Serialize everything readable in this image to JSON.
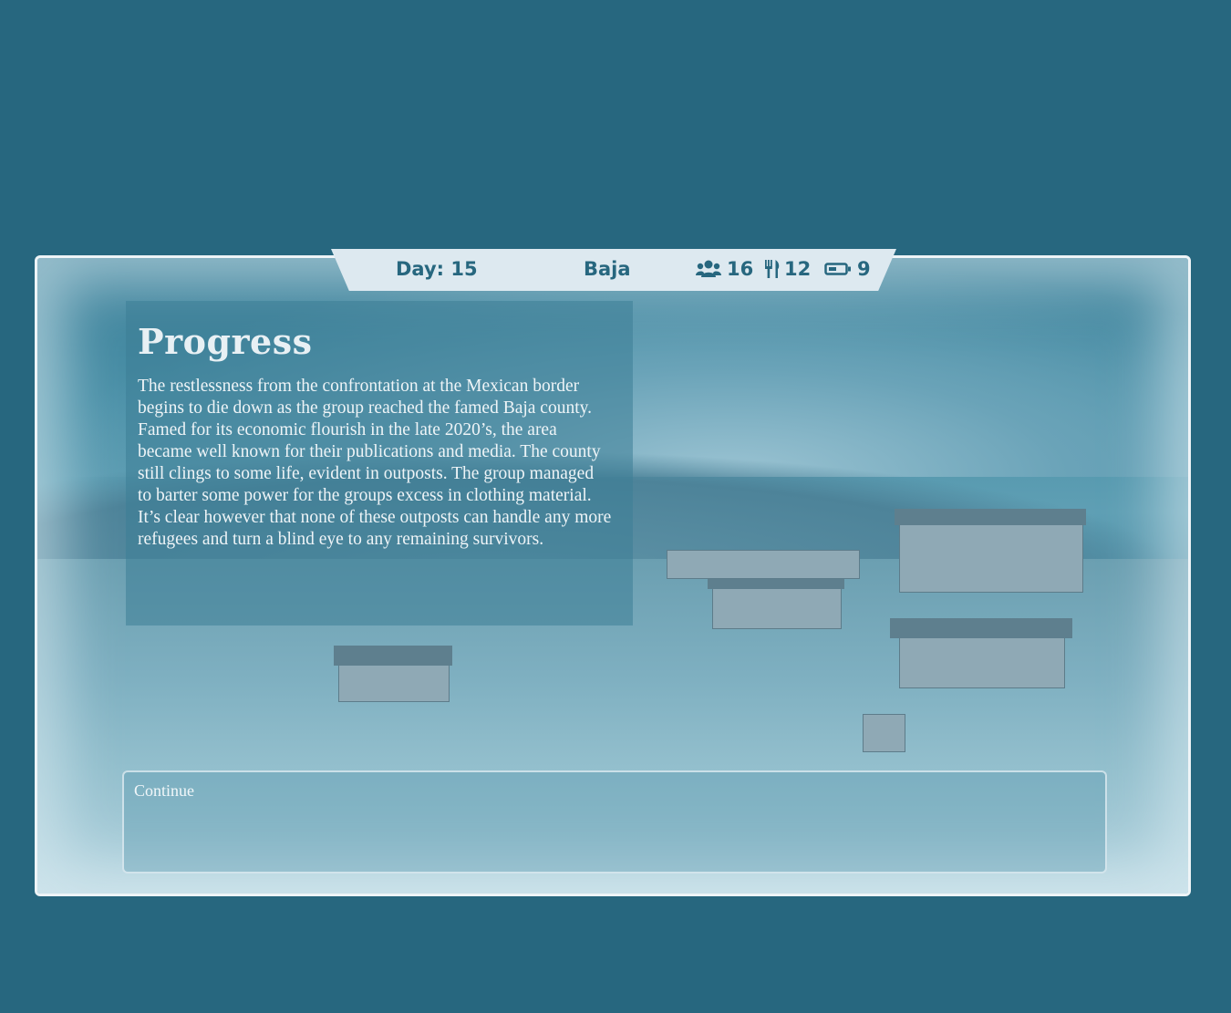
{
  "status_bar": {
    "day": "Day: 15",
    "location": "Baja",
    "party_icon": "users-icon",
    "party_count": "16",
    "food_icon": "utensils-icon",
    "food_count": "12",
    "power_icon": "battery-icon",
    "power_count": "9"
  },
  "story": {
    "title": "Progress",
    "body": "The restlessness from the confrontation at the Mexican border begins to die down as the group reached the famed Baja county. Famed for its economic flourish in the late 2020’s, the area became well known for their publications and media. The county still clings to some life, evident in outposts. The group managed to barter some power for the groups excess in clothing material. It’s clear however that none of these outposts can handle any more refugees and turn a blind eye to any remaining survivors."
  },
  "choices": [
    {
      "label": "Continue"
    }
  ],
  "colors": {
    "background": "#27677f",
    "accent_text": "#27677f",
    "status_bar_bg": "#dde9f0"
  }
}
